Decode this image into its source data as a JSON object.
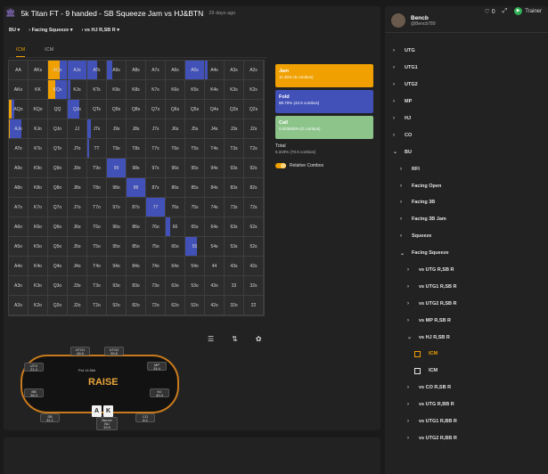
{
  "header": {
    "title": "5k Titan FT - 9 handed - SB Squeeze Jam vs HJ&BTN",
    "age": "29 days ago",
    "likes": "0",
    "trainer": "Trainer"
  },
  "crumbs": [
    "BU",
    "Facing Squeeze",
    "vs HJ R,SB R"
  ],
  "tabs": [
    "ICM",
    "ICM"
  ],
  "grid": {
    "rows": [
      [
        "AA",
        "AKs",
        "AQs",
        "AJs",
        "ATs",
        "A9s",
        "A8s",
        "A7s",
        "A6s",
        "A5s",
        "A4s",
        "A3s",
        "A2s"
      ],
      [
        "AKo",
        "KK",
        "KQs",
        "KJs",
        "KTs",
        "K9s",
        "K8s",
        "K7s",
        "K6s",
        "K5s",
        "K4s",
        "K3s",
        "K2s"
      ],
      [
        "AQo",
        "KQo",
        "QQ",
        "QJs",
        "QTs",
        "Q9s",
        "Q8s",
        "Q7s",
        "Q6s",
        "Q5s",
        "Q4s",
        "Q3s",
        "Q2s"
      ],
      [
        "AJo",
        "KJo",
        "QJo",
        "JJ",
        "JTs",
        "J9s",
        "J8s",
        "J7s",
        "J6s",
        "J5s",
        "J4s",
        "J3s",
        "J2s"
      ],
      [
        "ATo",
        "KTo",
        "QTo",
        "JTo",
        "TT",
        "T9s",
        "T8s",
        "T7s",
        "T6s",
        "T5s",
        "T4s",
        "T3s",
        "T2s"
      ],
      [
        "A9o",
        "K9o",
        "Q9o",
        "J9o",
        "T9o",
        "99",
        "98s",
        "97s",
        "96s",
        "95s",
        "94s",
        "93s",
        "92s"
      ],
      [
        "A8o",
        "K8o",
        "Q8o",
        "J8o",
        "T8o",
        "98o",
        "88",
        "87s",
        "86s",
        "85s",
        "84s",
        "83s",
        "82s"
      ],
      [
        "A7o",
        "K7o",
        "Q7o",
        "J7o",
        "T7o",
        "97o",
        "87o",
        "77",
        "76s",
        "75s",
        "74s",
        "73s",
        "72s"
      ],
      [
        "A6o",
        "K6o",
        "Q6o",
        "J6o",
        "T6o",
        "96o",
        "86o",
        "76o",
        "66",
        "65s",
        "64s",
        "63s",
        "62s"
      ],
      [
        "A5o",
        "K5o",
        "Q5o",
        "J5o",
        "T5o",
        "95o",
        "85o",
        "75o",
        "65o",
        "55",
        "54s",
        "53s",
        "52s"
      ],
      [
        "A4o",
        "K4o",
        "Q4o",
        "J4o",
        "T4o",
        "94o",
        "84o",
        "74o",
        "64o",
        "54o",
        "44",
        "43s",
        "42s"
      ],
      [
        "A3o",
        "K3o",
        "Q3o",
        "J3o",
        "T3o",
        "93o",
        "83o",
        "73o",
        "63o",
        "53o",
        "43o",
        "33",
        "32s"
      ],
      [
        "A2o",
        "K2o",
        "Q2o",
        "J2o",
        "T2o",
        "92o",
        "82o",
        "72o",
        "62o",
        "52o",
        "42o",
        "32o",
        "22"
      ]
    ],
    "jam_pct": {
      "AQs": 0.6,
      "KQs": 0.4,
      "AQo": 0.15,
      "AJo": 0.05
    },
    "fold_pct": {
      "AQs": 0.4,
      "AJs": 1,
      "ATs": 0.5,
      "A9s": 0.3,
      "A5s": 1,
      "A4s": 0.15,
      "KQs": 0.6,
      "KJs": 0.15,
      "AQo": 0.15,
      "QJs": 0.6,
      "AJo": 0.6,
      "JTs": 0.2,
      "TT": 0.1,
      "99": 1,
      "88": 1,
      "77": 1,
      "66": 0.25,
      "55": 0.6
    }
  },
  "legend": {
    "jam": {
      "label": "Jam",
      "detail": "11.35% (6 combos)"
    },
    "fold": {
      "label": "Fold",
      "detail": "88.70% (42.6 combos)"
    },
    "call": {
      "label": "Call",
      "detail": "0.003925% (0 combos)"
    },
    "total": {
      "label": "Total",
      "detail": "5.319% (70.5 combos)"
    },
    "relative": "Relative Combos"
  },
  "colors": {
    "jam": "#f0a000",
    "fold": "#4251b8",
    "call": "#8cc48a"
  },
  "table": {
    "logo": "RAISE",
    "pot": "Pot 14.5bb",
    "seats": [
      {
        "pos": "UTG1",
        "stack": "46.6"
      },
      {
        "pos": "UTG2",
        "stack": "39.8"
      },
      {
        "pos": "UTG",
        "stack": "21.4"
      },
      {
        "pos": "MP",
        "stack": "34.4"
      },
      {
        "pos": "BB",
        "stack": "38.3"
      },
      {
        "pos": "HJ",
        "stack": "40.4"
      },
      {
        "pos": "SB",
        "stack": "31.1"
      },
      {
        "pos": "CO",
        "stack": "8.2"
      }
    ],
    "hero": {
      "name": "Bencb",
      "pos": "BU",
      "stack": "33.6"
    },
    "cards": [
      "A",
      "K"
    ]
  },
  "profile": {
    "name": "Bencb",
    "handle": "@Bencb789"
  },
  "tree": [
    {
      "label": "UTG",
      "d": 0,
      "ch": "›"
    },
    {
      "label": "UTG1",
      "d": 0,
      "ch": "›"
    },
    {
      "label": "UTG2",
      "d": 0,
      "ch": "›"
    },
    {
      "label": "MP",
      "d": 0,
      "ch": "›"
    },
    {
      "label": "HJ",
      "d": 0,
      "ch": "›"
    },
    {
      "label": "CO",
      "d": 0,
      "ch": "›"
    },
    {
      "label": "BU",
      "d": 0,
      "ch": "⌄"
    },
    {
      "label": "RFI",
      "d": 1,
      "ch": "›"
    },
    {
      "label": "Facing Open",
      "d": 1,
      "ch": "›"
    },
    {
      "label": "Facing 3B",
      "d": 1,
      "ch": "›"
    },
    {
      "label": "Facing 3B Jam",
      "d": 1,
      "ch": "›"
    },
    {
      "label": "Squeeze",
      "d": 1,
      "ch": "›"
    },
    {
      "label": "Facing Squeeze",
      "d": 1,
      "ch": "⌄"
    },
    {
      "label": "vs UTG R,SB R",
      "d": 2,
      "ch": "›"
    },
    {
      "label": "vs UTG1 R,SB R",
      "d": 2,
      "ch": "›"
    },
    {
      "label": "vs UTG2 R,SB R",
      "d": 2,
      "ch": "›"
    },
    {
      "label": "vs MP R,SB R",
      "d": 2,
      "ch": "›"
    },
    {
      "label": "vs HJ R,SB R",
      "d": 2,
      "ch": "⌄"
    },
    {
      "label": "ICM",
      "d": 3,
      "ch": "",
      "sel": true
    },
    {
      "label": "ICM",
      "d": 3,
      "ch": ""
    },
    {
      "label": "vs CO R,SB R",
      "d": 2,
      "ch": "›"
    },
    {
      "label": "vs UTG R,BB R",
      "d": 2,
      "ch": "›"
    },
    {
      "label": "vs UTG1 R,BB R",
      "d": 2,
      "ch": "›"
    },
    {
      "label": "vs UTG2 R,BB R",
      "d": 2,
      "ch": "›"
    }
  ]
}
